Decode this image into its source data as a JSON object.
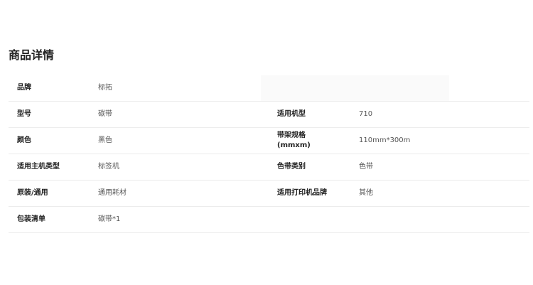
{
  "section_title": "商品详情",
  "rows": [
    {
      "label1": "品牌",
      "value1": "标拓",
      "label2": "",
      "value2": ""
    },
    {
      "label1": "型号",
      "value1": "碳带",
      "label2": "适用机型",
      "value2": "710"
    },
    {
      "label1": "颜色",
      "value1": "黑色",
      "label2": "带架规格\n(mmxm)",
      "value2": "110mm*300m"
    },
    {
      "label1": "适用主机类型",
      "value1": "标签机",
      "label2": "色带类别",
      "value2": "色带"
    },
    {
      "label1": "原装/通用",
      "value1": "通用耗材",
      "label2": "适用打印机品牌",
      "value2": "其他"
    },
    {
      "label1": "包装清单",
      "value1": "碳带*1",
      "label2": "",
      "value2": ""
    }
  ]
}
